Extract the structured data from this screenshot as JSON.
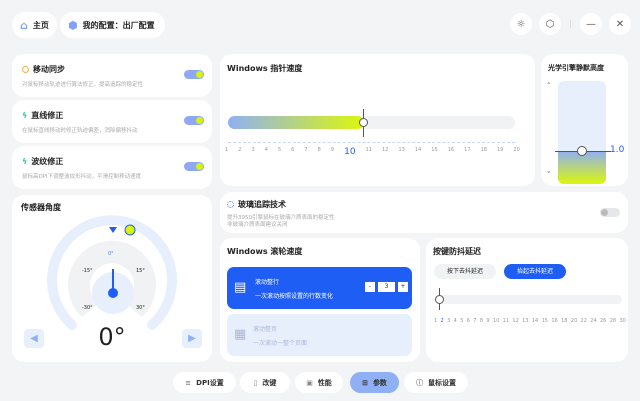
{
  "header": {
    "home": "主页",
    "profile": "我的配置：出厂配置"
  },
  "toggles": [
    {
      "title": "移动同步",
      "desc": "对鼠标移动轨迹进行算法修正，提高追踪的稳定性",
      "on": true
    },
    {
      "title": "直线修正",
      "desc": "在鼠标直线移动时修正轨迹偏差，消除偏移抖动",
      "on": true
    },
    {
      "title": "波纹修正",
      "desc": "鼠标高DPI下调整波纹形抖动，平滑控制移动速度",
      "on": true
    }
  ],
  "sensor": {
    "title": "传感器角度",
    "value": "0°",
    "labels": [
      "0°",
      "-15°",
      "15°",
      "-30°",
      "30°"
    ]
  },
  "pointer": {
    "title": "Windows 指针速度",
    "value": "10",
    "min": 1,
    "max": 20,
    "ticks": [
      "1",
      "2",
      "3",
      "4",
      "5",
      "6",
      "7",
      "8",
      "9",
      "10",
      "11",
      "12",
      "13",
      "14",
      "15",
      "16",
      "17",
      "18",
      "19",
      "20"
    ]
  },
  "lod": {
    "title": "光学引擎静默高度",
    "value": "1.0"
  },
  "glass": {
    "title": "玻璃追踪技术",
    "desc1": "提升3950引擎鼠标在玻璃介质表面的稳定性",
    "desc2": "非玻璃介质表面建议关闭",
    "on": false
  },
  "scroll": {
    "title": "Windows 滚轮速度",
    "opt1_title": "滚动整行",
    "opt1_desc": "一次滚动按照设置的行数变化",
    "lines": "3",
    "minus": "-",
    "plus": "+",
    "opt2_title": "滚动整页",
    "opt2_desc": "一次滚动一整个页面"
  },
  "debounce": {
    "title": "按键防抖延迟",
    "btn_press": "按下去抖延迟",
    "btn_release": "抬起去抖延迟",
    "value": 2,
    "ticks": [
      "1",
      "2",
      "3",
      "4",
      "5",
      "6",
      "7",
      "8",
      "9",
      "10",
      "11",
      "12",
      "13",
      "14",
      "15",
      "16",
      "18",
      "20",
      "22",
      "24",
      "26",
      "28",
      "30"
    ]
  },
  "nav": [
    {
      "label": "DPI设置"
    },
    {
      "label": "改键"
    },
    {
      "label": "性能"
    },
    {
      "label": "参数",
      "active": true
    },
    {
      "label": "鼠标设置"
    }
  ]
}
